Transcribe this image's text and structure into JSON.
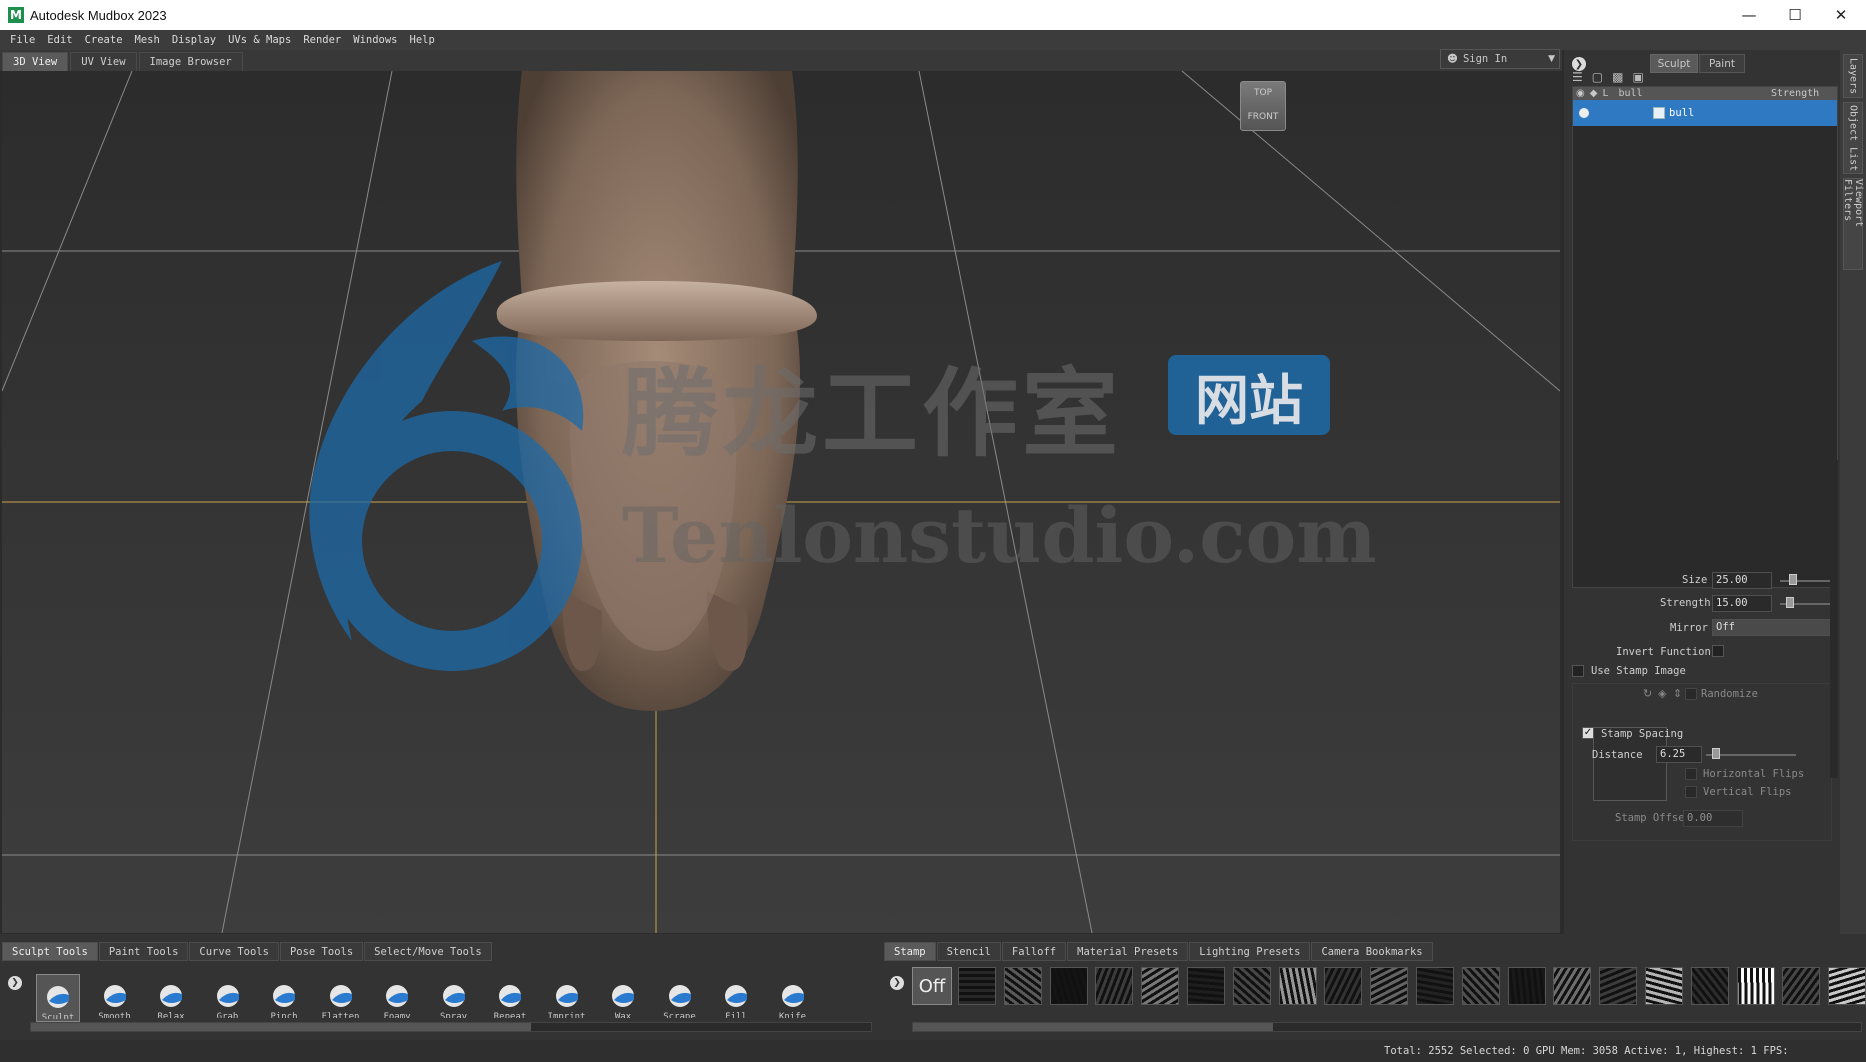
{
  "window": {
    "title": "Autodesk Mudbox 2023",
    "logo_letter": "M"
  },
  "menu": [
    "File",
    "Edit",
    "Create",
    "Mesh",
    "Display",
    "UVs & Maps",
    "Render",
    "Windows",
    "Help"
  ],
  "view_tabs": [
    "3D View",
    "UV View",
    "Image Browser"
  ],
  "sign_in": "Sign In",
  "viewcube": {
    "top": "TOP",
    "front": "FRONT"
  },
  "watermark": {
    "cn": "腾龙工作室",
    "badge": "网站",
    "url": "Tenlonstudio.com"
  },
  "panel": {
    "mode_tabs": [
      "Sculpt",
      "Paint"
    ],
    "layers_header": {
      "lock": "L",
      "name": "bull",
      "strength": "Strength"
    },
    "layer_row": "bull"
  },
  "side_tabs": [
    "Layers",
    "Object List",
    "Viewport Filters"
  ],
  "props": {
    "size_label": "Size",
    "size_value": "25.00",
    "strength_label": "Strength",
    "strength_value": "15.00",
    "mirror_label": "Mirror",
    "mirror_value": "Off",
    "invert_label": "Invert Function",
    "stamp_image_label": "Use Stamp Image",
    "randomize_label": "Randomize",
    "hflip_label": "Horizontal Flips",
    "vflip_label": "Vertical Flips",
    "stamp_offset_label": "Stamp Offset",
    "stamp_offset_value": "0.00",
    "stamp_spacing_label": "Stamp Spacing",
    "distance_label": "Distance",
    "distance_value": "6.25"
  },
  "tool_tabs": [
    "Sculpt Tools",
    "Paint Tools",
    "Curve Tools",
    "Pose Tools",
    "Select/Move Tools"
  ],
  "tools": [
    "Sculpt",
    "Smooth",
    "Relax",
    "Grab",
    "Pinch",
    "Flatten",
    "Foamy",
    "Spray",
    "Repeat",
    "Imprint",
    "Wax",
    "Scrape",
    "Fill",
    "Knife"
  ],
  "stamp_tabs": [
    "Stamp",
    "Stencil",
    "Falloff",
    "Material Presets",
    "Lighting Presets",
    "Camera Bookmarks"
  ],
  "stamp_off": "Off",
  "status": "Total: 2552  Selected: 0 GPU Mem: 3058  Active: 1, Highest: 1  FPS:"
}
